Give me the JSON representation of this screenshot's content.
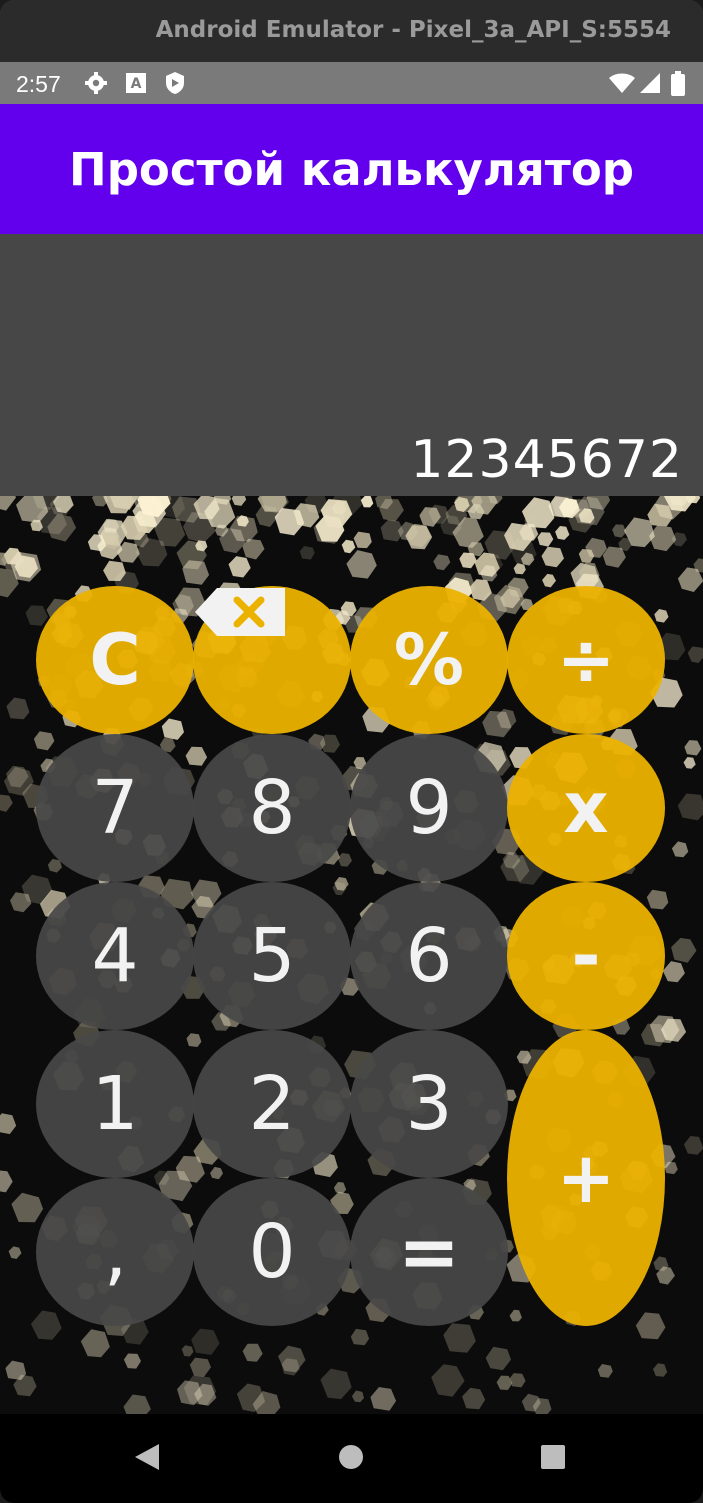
{
  "window": {
    "title": "Android Emulator - Pixel_3a_API_S:5554"
  },
  "status_bar": {
    "time": "2:57",
    "icons": [
      "gear-icon",
      "a-icon",
      "shield-icon",
      "wifi-icon",
      "signal-icon",
      "battery-icon"
    ]
  },
  "app_bar": {
    "title": "Простой калькулятор"
  },
  "display": {
    "value": "12345672"
  },
  "keys": {
    "clear": "C",
    "backspace": "backspace-icon",
    "percent": "%",
    "divide": "÷",
    "seven": "7",
    "eight": "8",
    "nine": "9",
    "multiply": "x",
    "four": "4",
    "five": "5",
    "six": "6",
    "minus": "-",
    "one": "1",
    "two": "2",
    "three": "3",
    "plus": "+",
    "comma": "‚",
    "zero": "0",
    "equals": "="
  },
  "colors": {
    "app_bar": "#6200ee",
    "operator_key": "#ecb200",
    "number_key": "#484848",
    "display_bg": "#474747"
  },
  "nav_bar": {
    "icons": [
      "back-icon",
      "home-icon",
      "recents-icon"
    ]
  }
}
